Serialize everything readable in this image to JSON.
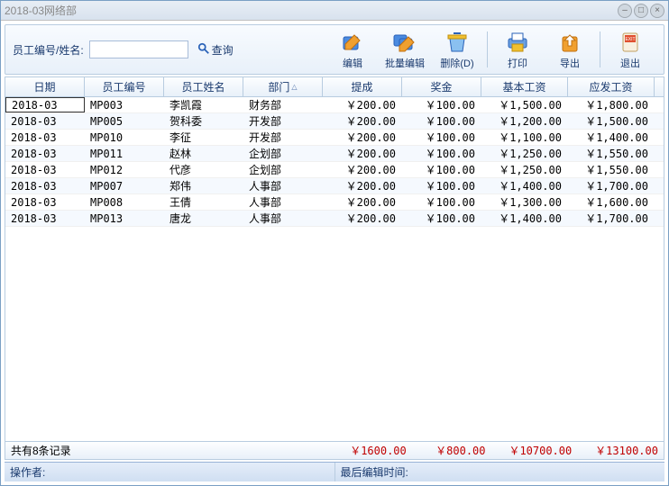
{
  "window": {
    "title": "2018-03网络部"
  },
  "toolbar": {
    "search_label": "员工编号/姓名:",
    "search_value": "",
    "query_label": "查询",
    "buttons": {
      "edit": "编辑",
      "batch_edit": "批量编辑",
      "delete": "删除(D)",
      "print": "打印",
      "export": "导出",
      "exit": "退出"
    }
  },
  "table": {
    "headers": [
      "日期",
      "员工编号",
      "员工姓名",
      "部门",
      "提成",
      "奖金",
      "基本工资",
      "应发工资"
    ],
    "rows": [
      {
        "date": "2018-03",
        "id": "MP003",
        "name": "李凯霞",
        "dept": "财务部",
        "commission": "￥200.00",
        "bonus": "￥100.00",
        "base": "￥1,500.00",
        "pay": "￥1,800.00"
      },
      {
        "date": "2018-03",
        "id": "MP005",
        "name": "贺科委",
        "dept": "开发部",
        "commission": "￥200.00",
        "bonus": "￥100.00",
        "base": "￥1,200.00",
        "pay": "￥1,500.00"
      },
      {
        "date": "2018-03",
        "id": "MP010",
        "name": "李征",
        "dept": "开发部",
        "commission": "￥200.00",
        "bonus": "￥100.00",
        "base": "￥1,100.00",
        "pay": "￥1,400.00"
      },
      {
        "date": "2018-03",
        "id": "MP011",
        "name": "赵林",
        "dept": "企划部",
        "commission": "￥200.00",
        "bonus": "￥100.00",
        "base": "￥1,250.00",
        "pay": "￥1,550.00"
      },
      {
        "date": "2018-03",
        "id": "MP012",
        "name": "代彦",
        "dept": "企划部",
        "commission": "￥200.00",
        "bonus": "￥100.00",
        "base": "￥1,250.00",
        "pay": "￥1,550.00"
      },
      {
        "date": "2018-03",
        "id": "MP007",
        "name": "郑伟",
        "dept": "人事部",
        "commission": "￥200.00",
        "bonus": "￥100.00",
        "base": "￥1,400.00",
        "pay": "￥1,700.00"
      },
      {
        "date": "2018-03",
        "id": "MP008",
        "name": "王倩",
        "dept": "人事部",
        "commission": "￥200.00",
        "bonus": "￥100.00",
        "base": "￥1,300.00",
        "pay": "￥1,600.00"
      },
      {
        "date": "2018-03",
        "id": "MP013",
        "name": "唐龙",
        "dept": "人事部",
        "commission": "￥200.00",
        "bonus": "￥100.00",
        "base": "￥1,400.00",
        "pay": "￥1,700.00"
      }
    ]
  },
  "footer": {
    "count_text": "共有8条记录",
    "totals": {
      "commission": "￥1600.00",
      "bonus": "￥800.00",
      "base": "￥10700.00",
      "pay": "￥13100.00"
    }
  },
  "statusbar": {
    "operator_label": "操作者:",
    "last_edit_label": "最后编辑时间:"
  }
}
